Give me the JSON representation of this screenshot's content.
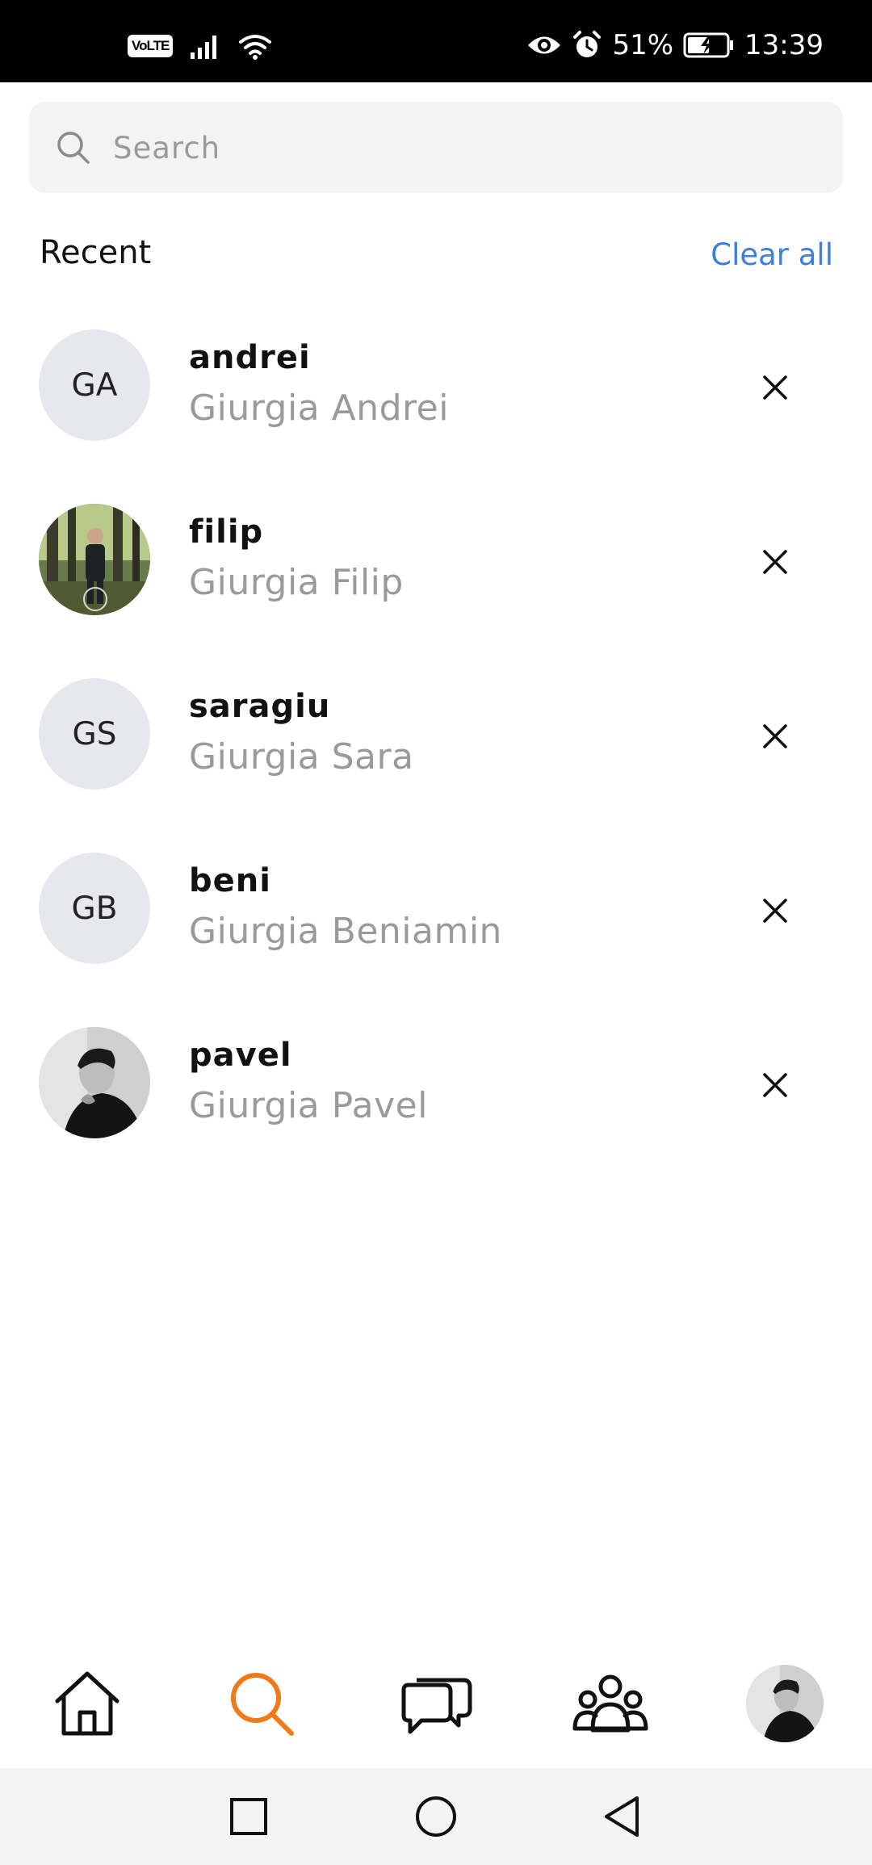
{
  "status_bar": {
    "network_badge": "VoLTE",
    "battery_percent": "51%",
    "time": "13:39",
    "icons": [
      "signal-icon",
      "wifi-icon",
      "eye-icon",
      "alarm-icon",
      "battery-charging-icon"
    ]
  },
  "search": {
    "placeholder": "Search",
    "value": ""
  },
  "recent": {
    "title": "Recent",
    "clear_label": "Clear all",
    "items": [
      {
        "username": "andrei",
        "full_name": "Giurgia Andrei",
        "initials": "GA",
        "avatar_type": "initials"
      },
      {
        "username": "filip",
        "full_name": "Giurgia Filip",
        "initials": "",
        "avatar_type": "photo-forest"
      },
      {
        "username": "saragiu",
        "full_name": "Giurgia Sara",
        "initials": "GS",
        "avatar_type": "initials"
      },
      {
        "username": "beni",
        "full_name": "Giurgia Beniamin",
        "initials": "GB",
        "avatar_type": "initials"
      },
      {
        "username": "pavel",
        "full_name": "Giurgia Pavel",
        "initials": "",
        "avatar_type": "photo-bw"
      }
    ]
  },
  "bottom_nav": {
    "items": [
      "home-icon",
      "search-icon",
      "chat-icon",
      "groups-icon",
      "profile-avatar"
    ],
    "active": "search-icon"
  },
  "colors": {
    "accent": "#f07a1a",
    "link": "#3b7fe0",
    "secondary_text": "#9a9a9a",
    "avatar_bg": "#e7e8ed"
  }
}
